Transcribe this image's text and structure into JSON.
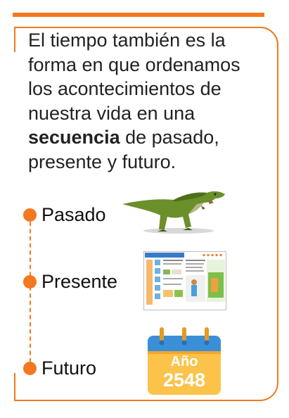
{
  "intro": {
    "before": "El tiempo también es la forma en que ordenamos los acontecimientos de nuestra vida en una",
    "bold": "secuencia",
    "after": "de pasado, presente y futuro."
  },
  "timeline": {
    "past_label": "Pasado",
    "present_label": "Presente",
    "future_label": "Futuro"
  },
  "calendar": {
    "word": "Año",
    "year": "2548"
  },
  "colors": {
    "accent": "#f4781f",
    "calendar_blue": "#3a8fd8",
    "calendar_yellow": "#fbc34a"
  }
}
